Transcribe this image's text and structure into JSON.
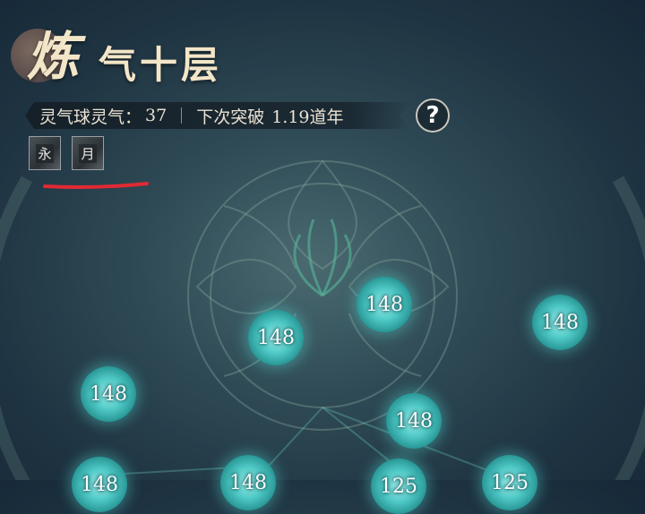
{
  "header": {
    "title_main": "炼",
    "title_sub": "气十层"
  },
  "status": {
    "qi_label": "灵气球灵气：",
    "qi_value": "37",
    "next_label": "下次突破",
    "next_value": "1.19道年"
  },
  "help": {
    "label": "?"
  },
  "badges": [
    "永",
    "月"
  ],
  "orbs": [
    "148",
    "148",
    "148",
    "148",
    "148",
    "148",
    "148",
    "125",
    "125"
  ],
  "colors": {
    "title": "#f3e6c8",
    "orb_glow": "#4fc9c6",
    "underline": "#e02a34",
    "background": "#2f4b56"
  }
}
